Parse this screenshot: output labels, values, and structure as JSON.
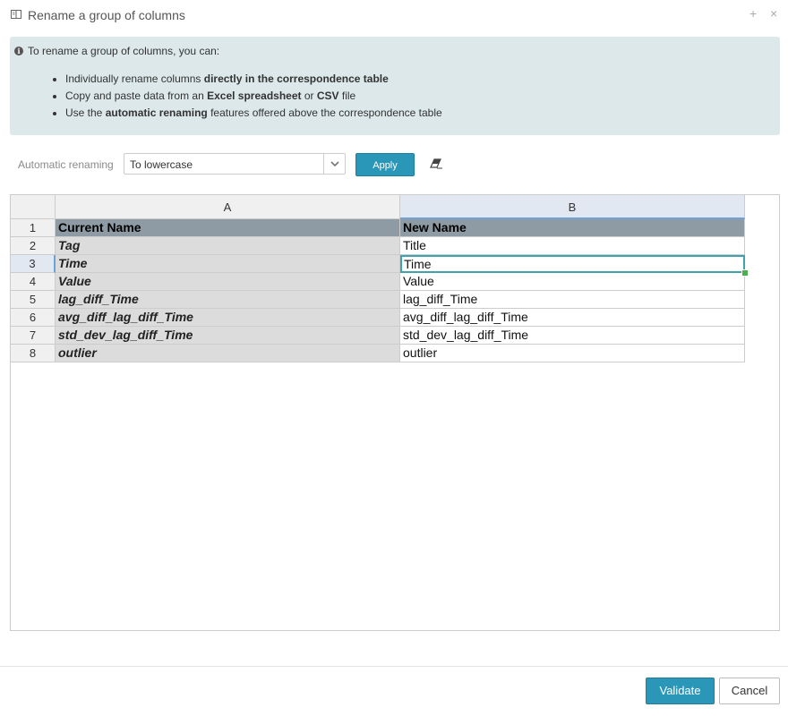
{
  "dialog": {
    "title": "Rename a group of columns",
    "icon": "columns-icon",
    "controls": {
      "add": "+",
      "close": "×"
    }
  },
  "info": {
    "icon": "info-icon",
    "intro": "To rename a group of columns, you can:",
    "items": [
      {
        "pre": "Individually rename columns ",
        "bold": "directly in the correspondence table",
        "mid": "",
        "bold2": "",
        "post": ""
      },
      {
        "pre": "Copy and paste data from an ",
        "bold": "Excel spreadsheet",
        "mid": " or ",
        "bold2": "CSV",
        "post": " file"
      },
      {
        "pre": "Use the ",
        "bold": "automatic renaming",
        "mid": " features offered above the correspondence table",
        "bold2": "",
        "post": ""
      }
    ]
  },
  "renaming": {
    "label": "Automatic renaming",
    "selected": "To lowercase",
    "apply_label": "Apply",
    "eraser_icon": "eraser-icon"
  },
  "grid": {
    "column_headers": [
      "A",
      "B"
    ],
    "selected_column": "B",
    "selected_row": 3,
    "rows": [
      {
        "n": "1",
        "a": "Current Name",
        "b": "New Name"
      },
      {
        "n": "2",
        "a": "Tag",
        "b": "Title"
      },
      {
        "n": "3",
        "a": "Time",
        "b": "Time"
      },
      {
        "n": "4",
        "a": "Value",
        "b": "Value"
      },
      {
        "n": "5",
        "a": "lag_diff_Time",
        "b": "lag_diff_Time"
      },
      {
        "n": "6",
        "a": "avg_diff_lag_diff_Time",
        "b": "avg_diff_lag_diff_Time"
      },
      {
        "n": "7",
        "a": "std_dev_lag_diff_Time",
        "b": "std_dev_lag_diff_Time"
      },
      {
        "n": "8",
        "a": "outlier",
        "b": "outlier"
      }
    ]
  },
  "footer": {
    "validate_label": "Validate",
    "cancel_label": "Cancel"
  },
  "colors": {
    "accent": "#2a97b8",
    "info_bg": "#dce8ea",
    "header_row_bg": "#8e9ba4",
    "source_col_bg": "#dcdcdc",
    "active_cell_border": "#3fa3ad"
  }
}
